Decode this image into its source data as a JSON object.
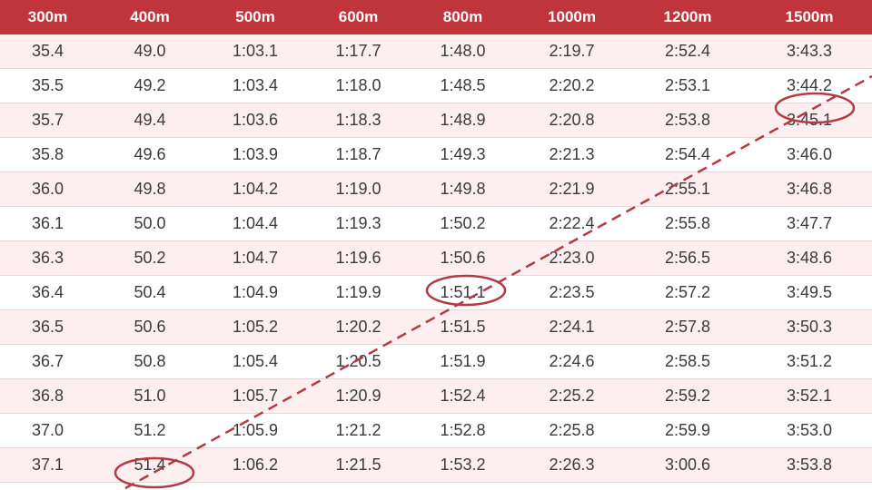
{
  "table": {
    "headers": [
      "300m",
      "400m",
      "500m",
      "600m",
      "800m",
      "1000m",
      "1200m",
      "1500m"
    ],
    "rows": [
      [
        "35.4",
        "49.0",
        "1:03.1",
        "1:17.7",
        "1:48.0",
        "2:19.7",
        "2:52.4",
        "3:43.3"
      ],
      [
        "35.5",
        "49.2",
        "1:03.4",
        "1:18.0",
        "1:48.5",
        "2:20.2",
        "2:53.1",
        "3:44.2"
      ],
      [
        "35.7",
        "49.4",
        "1:03.6",
        "1:18.3",
        "1:48.9",
        "2:20.8",
        "2:53.8",
        "3:45.1"
      ],
      [
        "35.8",
        "49.6",
        "1:03.9",
        "1:18.7",
        "1:49.3",
        "2:21.3",
        "2:54.4",
        "3:46.0"
      ],
      [
        "36.0",
        "49.8",
        "1:04.2",
        "1:19.0",
        "1:49.8",
        "2:21.9",
        "2:55.1",
        "3:46.8"
      ],
      [
        "36.1",
        "50.0",
        "1:04.4",
        "1:19.3",
        "1:50.2",
        "2:22.4",
        "2:55.8",
        "3:47.7"
      ],
      [
        "36.3",
        "50.2",
        "1:04.7",
        "1:19.6",
        "1:50.6",
        "2:23.0",
        "2:56.5",
        "3:48.6"
      ],
      [
        "36.4",
        "50.4",
        "1:04.9",
        "1:19.9",
        "1:51.1",
        "2:23.5",
        "2:57.2",
        "3:49.5"
      ],
      [
        "36.5",
        "50.6",
        "1:05.2",
        "1:20.2",
        "1:51.5",
        "2:24.1",
        "2:57.8",
        "3:50.3"
      ],
      [
        "36.7",
        "50.8",
        "1:05.4",
        "1:20.5",
        "1:51.9",
        "2:24.6",
        "2:58.5",
        "3:51.2"
      ],
      [
        "36.8",
        "51.0",
        "1:05.7",
        "1:20.9",
        "1:52.4",
        "2:25.2",
        "2:59.2",
        "3:52.1"
      ],
      [
        "37.0",
        "51.2",
        "1:05.9",
        "1:21.2",
        "1:52.8",
        "2:25.8",
        "2:59.9",
        "3:53.0"
      ],
      [
        "37.1",
        "51.4",
        "1:06.2",
        "1:21.5",
        "1:53.2",
        "2:26.3",
        "3:00.6",
        "3:53.8"
      ]
    ]
  },
  "colors": {
    "header_background": "#c0343b",
    "header_text": "#ffffff",
    "row_alt_background": "#fdeff0",
    "annotation": "#b33a42"
  },
  "annotations": {
    "circled_cells": [
      "51.4",
      "1:51.1",
      "3:45.1"
    ],
    "line_style": "dashed"
  }
}
